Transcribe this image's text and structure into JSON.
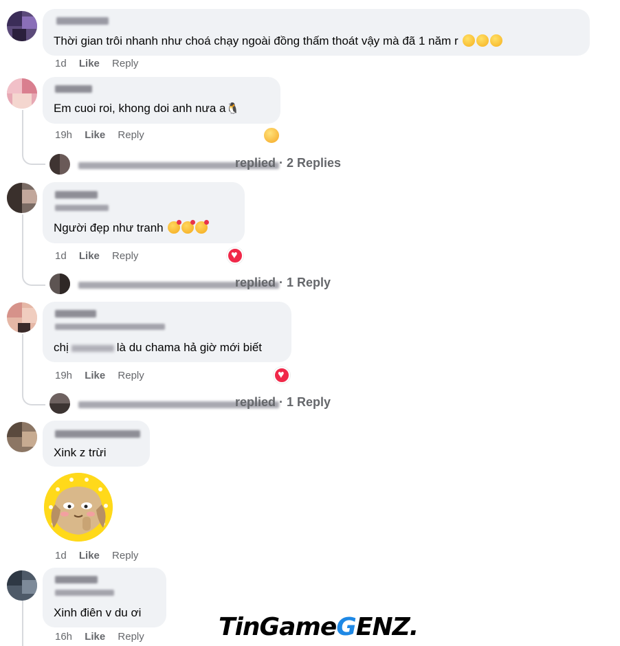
{
  "comments": [
    {
      "text": "Thời gian trôi nhanh như choá chạy ngoài đồng thấm thoát vậy mà đã 1 năm r",
      "time": "1d"
    },
    {
      "text": "Em cuoi roi, khong doi anh nưa a",
      "time": "19h",
      "thread_text": "replied · 2 Replies"
    },
    {
      "text": "Người đẹp như tranh",
      "time": "1d",
      "thread_text": "replied · 1 Reply"
    },
    {
      "text_prefix": "chị",
      "text_suffix": "là du chama hả giờ mới biết",
      "time": "19h",
      "thread_text": "replied · 1 Reply"
    },
    {
      "text": "Xink z trừi",
      "time": "1d"
    },
    {
      "text": "Xinh điên v du ơi",
      "time": "16h"
    }
  ],
  "actions": {
    "like": "Like",
    "reply": "Reply"
  },
  "watermark": {
    "part1": "TinGame",
    "part2": "G",
    "part3": "ENZ."
  },
  "reaction_types": [
    "haha",
    "love",
    "love"
  ],
  "colors": {
    "bubble": "#f0f2f5",
    "meta": "#65676b",
    "accent": "#1e88e5",
    "love": "#f02849"
  }
}
